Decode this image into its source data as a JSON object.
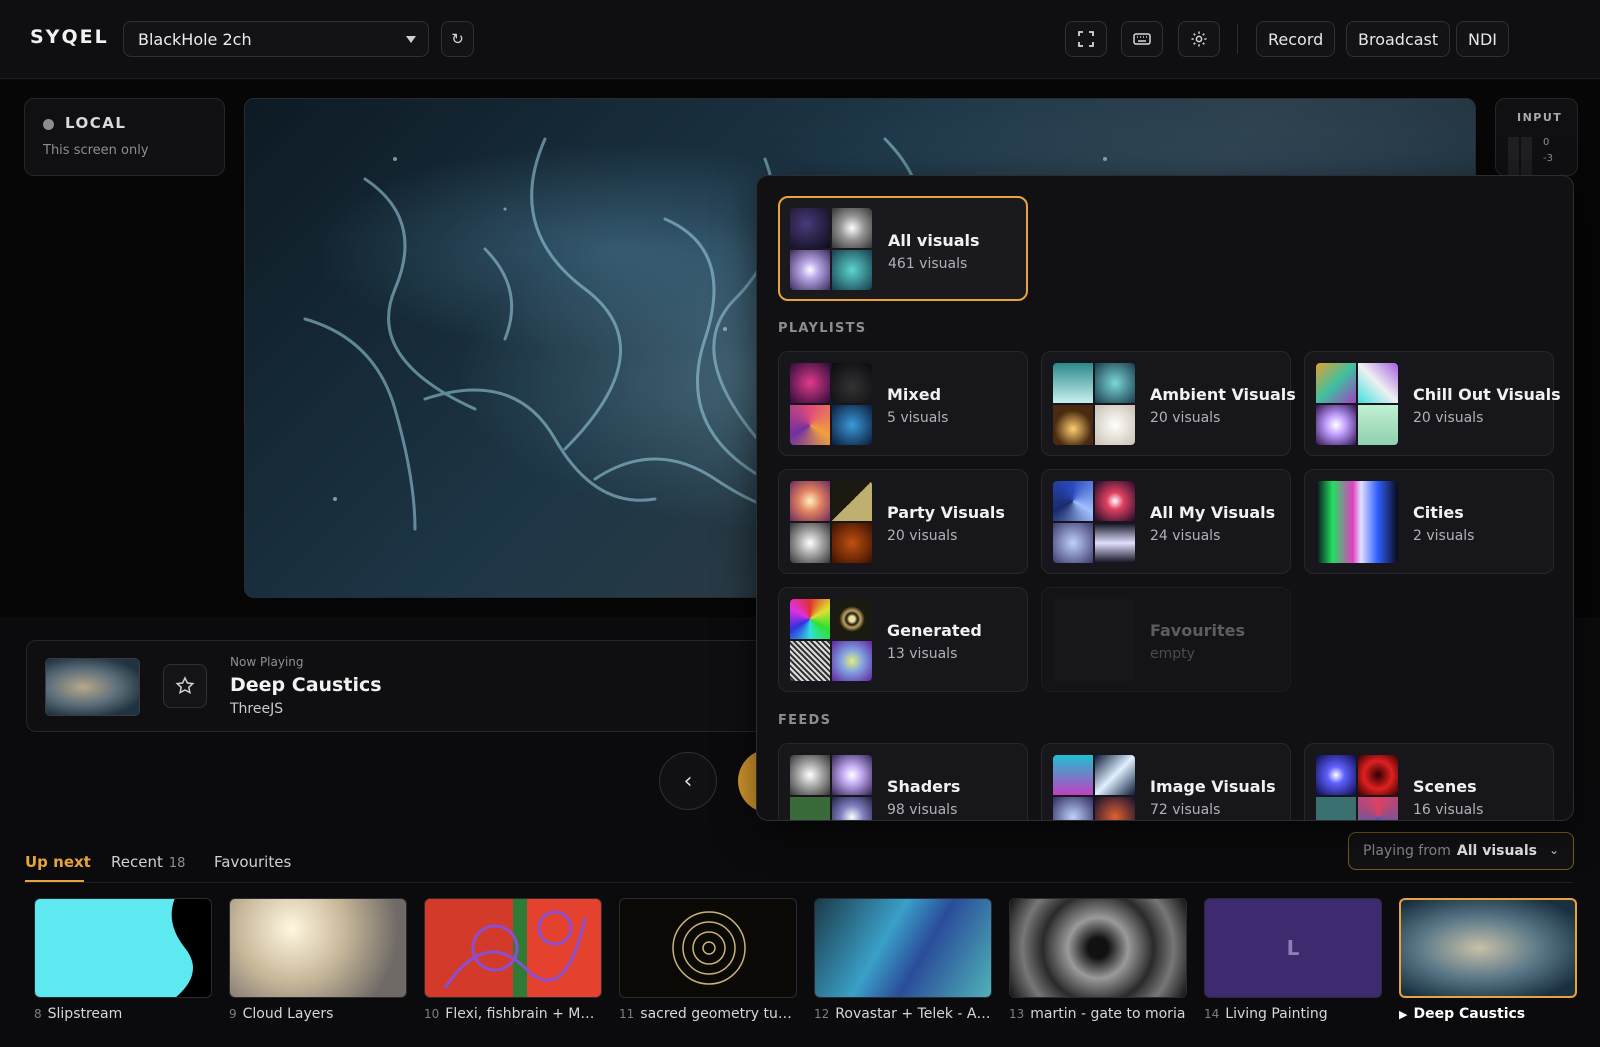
{
  "header": {
    "logo": "SYQEL",
    "device": "BlackHole 2ch",
    "refresh_icon": "↻",
    "icons": [
      "fullscreen-icon",
      "keyboard-icon",
      "gear-icon"
    ],
    "buttons": {
      "record": "Record",
      "broadcast": "Broadcast",
      "ndi": "NDI"
    }
  },
  "output": {
    "label": "LOCAL",
    "sub": "This screen only"
  },
  "input_meter": {
    "label": "INPUT",
    "ticks": [
      "0",
      "-3"
    ]
  },
  "now_playing": {
    "label": "Now Playing",
    "title": "Deep Caustics",
    "engine": "ThreeJS"
  },
  "controls": {
    "prev_icon": "‹"
  },
  "tabs": [
    {
      "label": "Up next",
      "count": ""
    },
    {
      "label": "Recent",
      "count": "18"
    },
    {
      "label": "Favourites",
      "count": ""
    }
  ],
  "playing_from": {
    "prefix": "Playing from",
    "value": "All visuals",
    "chevron": "⌄"
  },
  "queue": [
    {
      "num": "8",
      "name": "Slipstream"
    },
    {
      "num": "9",
      "name": "Cloud Layers"
    },
    {
      "num": "10",
      "name": "Flexi, fishbrain + Marti..."
    },
    {
      "num": "11",
      "name": "sacred geometry tunne..."
    },
    {
      "num": "12",
      "name": "Rovastar + Telek - Alta..."
    },
    {
      "num": "13",
      "name": "martin - gate to moria"
    },
    {
      "num": "14",
      "name": "Living Painting",
      "thumb_letter": "L"
    },
    {
      "num": "▶",
      "name": "Deep Caustics"
    }
  ],
  "library": {
    "all": {
      "name": "All visuals",
      "count": "461 visuals"
    },
    "playlists_label": "PLAYLISTS",
    "playlists": [
      {
        "name": "Mixed",
        "count": "5 visuals"
      },
      {
        "name": "Ambient Visuals",
        "count": "20 visuals"
      },
      {
        "name": "Chill Out Visuals",
        "count": "20 visuals"
      },
      {
        "name": "Party Visuals",
        "count": "20 visuals"
      },
      {
        "name": "All My Visuals",
        "count": "24 visuals"
      },
      {
        "name": "Cities",
        "count": "2 visuals"
      },
      {
        "name": "Generated",
        "count": "13 visuals"
      },
      {
        "name": "Favourites",
        "count": "empty"
      }
    ],
    "feeds_label": "FEEDS",
    "feeds": [
      {
        "name": "Shaders",
        "count": "98 visuals"
      },
      {
        "name": "Image Visuals",
        "count": "72 visuals"
      },
      {
        "name": "Scenes",
        "count": "16 visuals"
      }
    ]
  },
  "colors": {
    "accent": "#e7a43a",
    "background": "#0b0b0d",
    "panel": "#111114"
  }
}
